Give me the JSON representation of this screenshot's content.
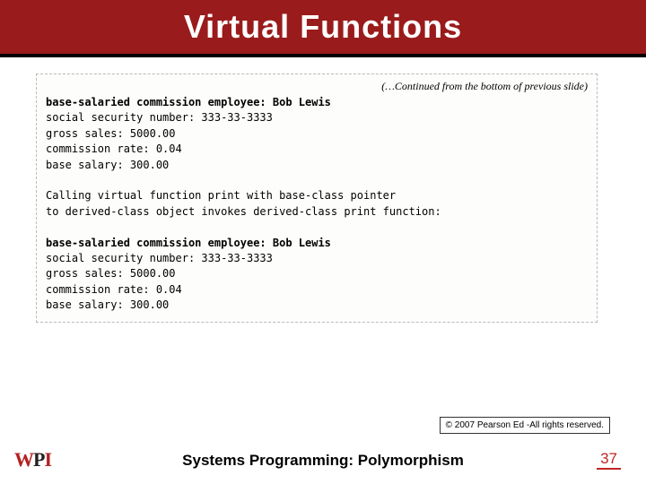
{
  "title": "Virtual Functions",
  "continued_note": "(…Continued from the bottom of previous slide)",
  "code": {
    "block1": {
      "l1a": "base-salaried commission employee: ",
      "l1b": "Bob Lewis",
      "l2": "social security number: 333-33-3333",
      "l3": "gross sales: 5000.00",
      "l4": "commission rate: 0.04",
      "l5": "base salary: 300.00"
    },
    "mid": {
      "l1": "Calling virtual function print with base-class pointer",
      "l2": "to derived-class object invokes derived-class print function:"
    },
    "block2": {
      "l1a": "base-salaried commission employee: ",
      "l1b": "Bob Lewis",
      "l2": "social security number: 333-33-3333",
      "l3": "gross sales: 5000.00",
      "l4": "commission rate: 0.04",
      "l5": "base salary: 300.00"
    }
  },
  "copyright": "© 2007 Pearson Ed -All rights reserved.",
  "logo": {
    "w": "W",
    "p": "P",
    "i": "I"
  },
  "footer_text": "Systems Programming:  Polymorphism",
  "page_number": "37"
}
